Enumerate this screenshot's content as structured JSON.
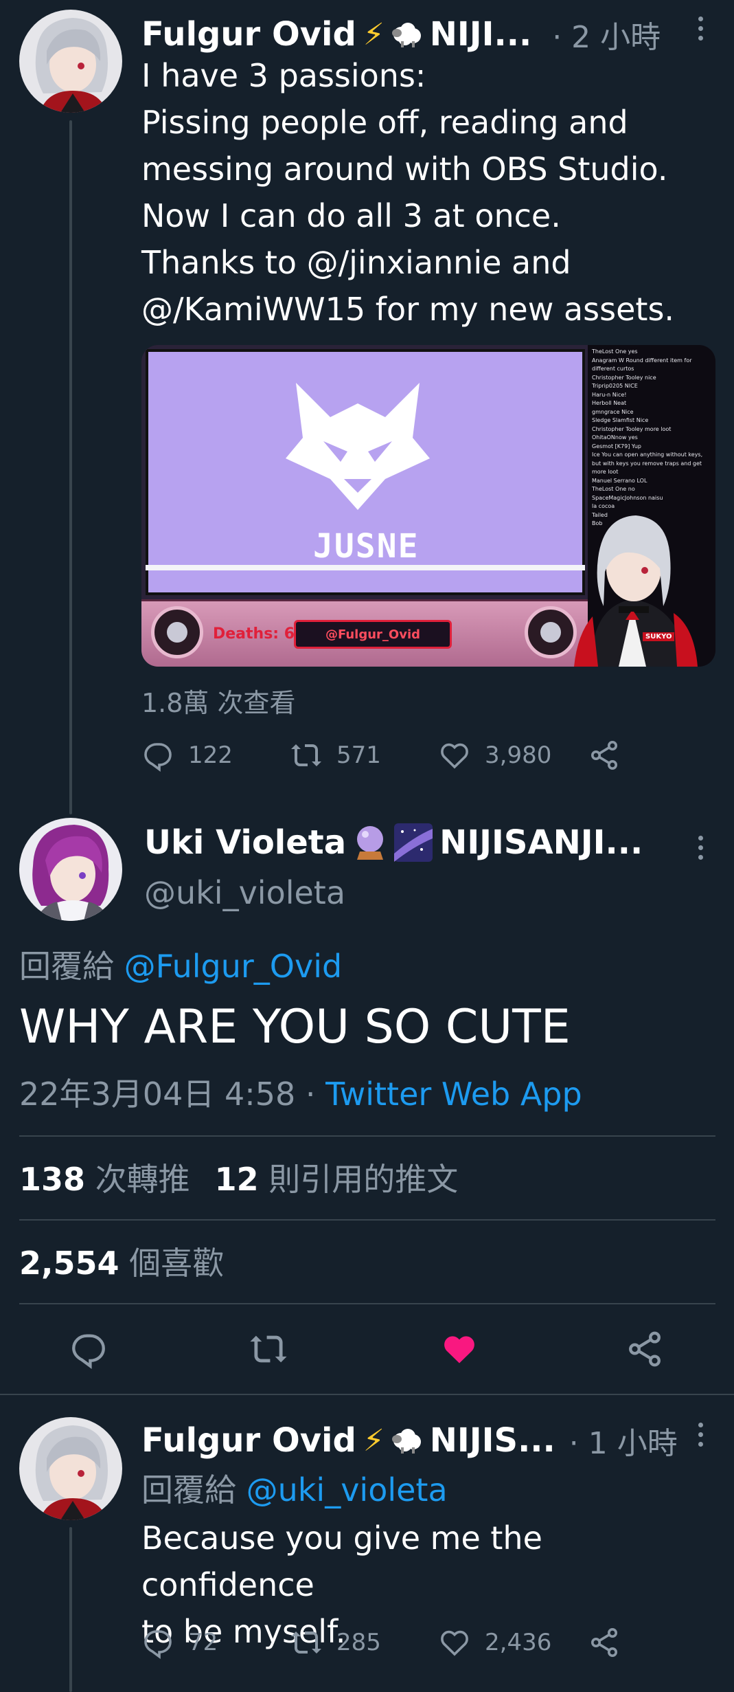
{
  "tweet1": {
    "display_name": "Fulgur Ovid",
    "name_suffix": "NIJI...",
    "time": "· 2 小時",
    "text_lines": [
      "I have 3 passions:",
      "Pissing people off, reading and",
      "messing around with OBS Studio.",
      "Now I can do all 3 at once.",
      "Thanks to @/jinxiannie and",
      "@/KamiWW15 for my new assets."
    ],
    "media": {
      "logo_text": "JUSNE",
      "deaths_label": "Deaths: 6",
      "handle_plate": "@Fulgur_Ovid",
      "chat_lines": [
        "TheLost One yes",
        "Anagram W Round different item for different curtos",
        "Christopher Tooley nice",
        "Triprip0205 NICE",
        "Haru-n Nice!",
        "Herboll Neat",
        "gmngrace Nice",
        "Sledge Slamfist Nice",
        "Christopher Tooley more loot",
        "OhitaONnow yes",
        "Gesmot [K79] Yup",
        "Ice You can open anything without keys, but with keys you remove traps and get more loot",
        "Manuel Serrano LOL",
        "TheLost One no",
        "SpaceMagicJohnson naisu",
        "la cocoa",
        "Tailed",
        "Bob"
      ],
      "vtuber_badge": "SUKYO"
    },
    "views": "1.8萬 次查看",
    "replies": "122",
    "retweets": "571",
    "likes": "3,980"
  },
  "tweet2": {
    "display_name": "Uki Violeta",
    "name_suffix": "NIJISANJI...",
    "handle": "@uki_violeta",
    "reply_prefix": "回覆給",
    "reply_to": "@Fulgur_Ovid",
    "text": "WHY ARE YOU SO CUTE",
    "datetime": "22年3月04日 4:58 ·",
    "source": "Twitter Web App",
    "retweet_count": "138",
    "retweet_label": "次轉推",
    "quote_count": "12",
    "quote_label": "則引用的推文",
    "like_count": "2,554",
    "like_label": "個喜歡"
  },
  "tweet3": {
    "display_name": "Fulgur Ovid",
    "name_suffix": "NIJIS...",
    "time": "· 1 小時",
    "reply_prefix": "回覆給",
    "reply_to": "@uki_violeta",
    "text_lines": [
      "Because you give me the confidence",
      "to be myself."
    ],
    "replies": "72",
    "retweets": "285",
    "likes": "2,436"
  },
  "colors": {
    "background": "#15202b",
    "accent": "#1d9bf0",
    "like_active": "#f91880",
    "muted": "#8b98a5",
    "divider": "#38444d",
    "media_purple": "#b7a2f0"
  }
}
